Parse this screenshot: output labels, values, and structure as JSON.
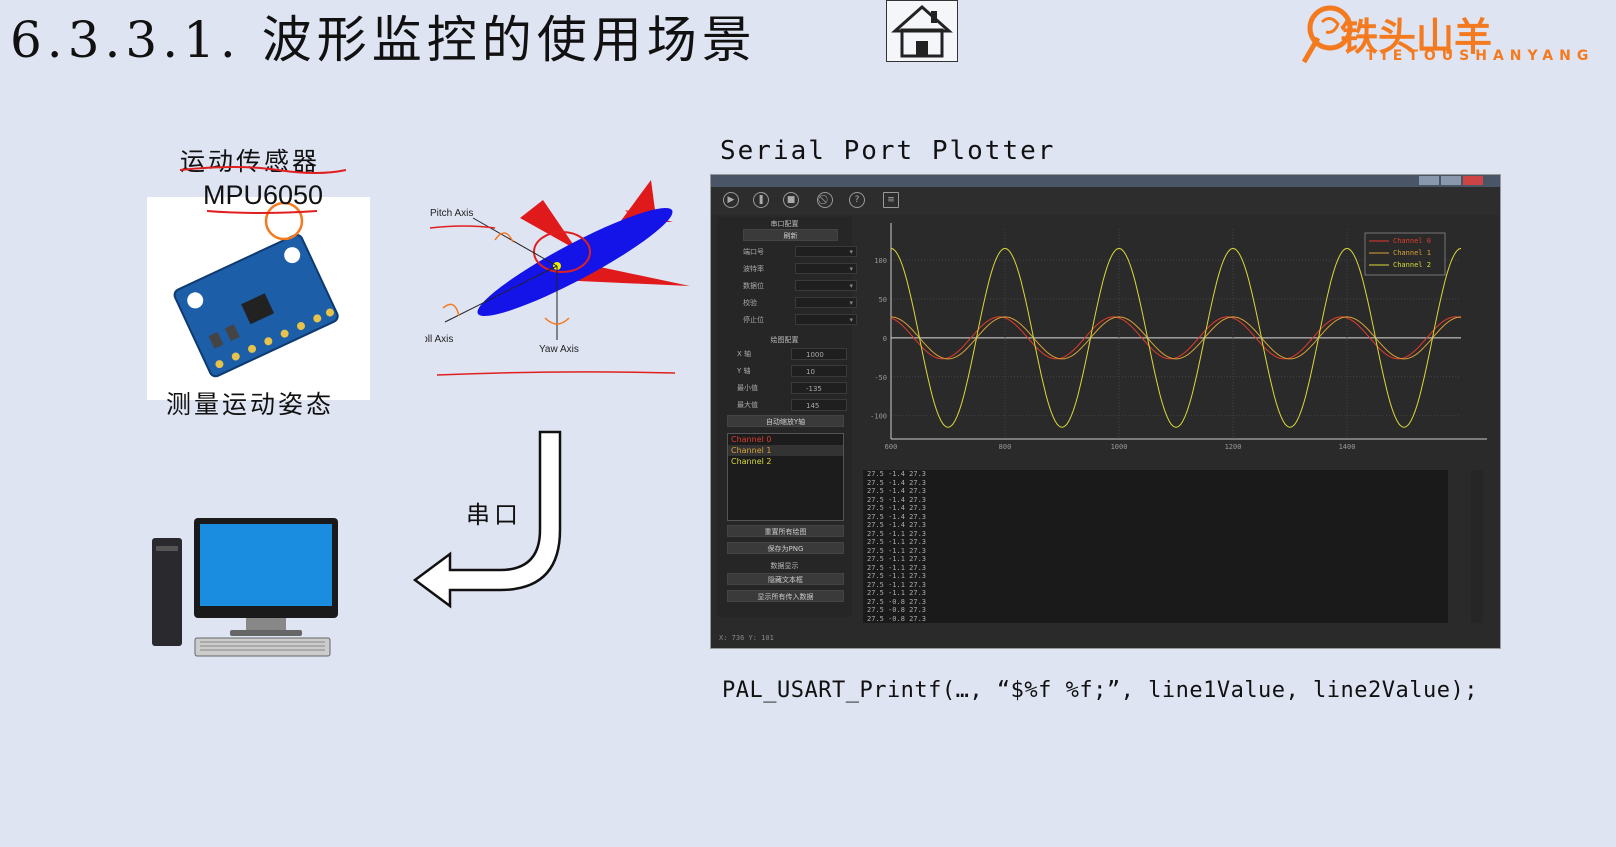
{
  "slide": {
    "title": "6.3.3.1. 波形监控的使用场景",
    "logo": {
      "main": "铁头山羊",
      "sub": "TIETOUSHANYANG"
    }
  },
  "sensor": {
    "label": "运动传感器",
    "model": "MPU6050",
    "caption": "测量运动姿态"
  },
  "airplane": {
    "pitch_axis": "Pitch Axis",
    "roll_axis": "Roll Axis",
    "yaw_axis": "Yaw Axis"
  },
  "link": {
    "label": "串口"
  },
  "plotter": {
    "title": "Serial Port Plotter",
    "toolbar": [
      "play-icon",
      "pause-icon",
      "stop-icon",
      "clear-icon",
      "help-icon",
      "document-icon"
    ],
    "sections": {
      "port_config": "串口配置",
      "refresh": "刷新",
      "port": "端口号",
      "baud": "波特率",
      "data_bits": "数据位",
      "parity": "校验",
      "stop_bits": "停止位",
      "plot_config": "绘图配置",
      "x_axis": "X 轴",
      "y_axis": "Y 轴",
      "min": "最小值",
      "max": "最大值",
      "auto_scale": "自动缩放Y轴",
      "reset_plots": "重置所有绘图",
      "save_png": "保存为PNG",
      "data_display": "数据显示",
      "hide_text": "隐藏文本框",
      "show_all": "显示所有传入数据"
    },
    "values": {
      "x": "1000",
      "y": "10",
      "min": "-135",
      "max": "145"
    },
    "channels": [
      {
        "name": "Channel 0",
        "color": "#e23b2e"
      },
      {
        "name": "Channel 1",
        "color": "#d8a236"
      },
      {
        "name": "Channel 2",
        "color": "#d9d93a"
      }
    ],
    "status": "X: 736 Y: 101",
    "console_lines": [
      "27.5 -1.4 27.3",
      "27.5 -1.4 27.3",
      "27.5 -1.4 27.3",
      "27.5 -1.4 27.3",
      "27.5 -1.4 27.3",
      "27.5 -1.4 27.3",
      "27.5 -1.4 27.3",
      "27.5 -1.1 27.3",
      "27.5 -1.1 27.3",
      "27.5 -1.1 27.3",
      "27.5 -1.1 27.3",
      "27.5 -1.1 27.3",
      "27.5 -1.1 27.3",
      "27.5 -1.1 27.3",
      "27.5 -1.1 27.3",
      "27.5 -0.8 27.3",
      "27.5 -0.8 27.3",
      "27.5 -0.8 27.3",
      "27.5 -0.8 27.3",
      "27.5 -0.8 27.3"
    ]
  },
  "chart_data": {
    "type": "line",
    "x_ticks": [
      "600",
      "800",
      "1000",
      "1200",
      "1400"
    ],
    "y_ticks": [
      "100",
      "50",
      "0",
      "-50",
      "-100"
    ],
    "xlim": [
      600,
      1600
    ],
    "ylim": [
      -130,
      140
    ],
    "grid": true,
    "legend_position": "top-right",
    "series": [
      {
        "name": "Channel 0",
        "color": "#e23b2e",
        "amplitude": 27,
        "period": 200,
        "phase": 10,
        "offset": 0
      },
      {
        "name": "Channel 1",
        "color": "#d8a236",
        "amplitude": 27,
        "period": 200,
        "phase": 0,
        "offset": 0
      },
      {
        "name": "Channel 2",
        "color": "#d9d93a",
        "amplitude": 115,
        "period": 200,
        "phase": 0,
        "offset": 0
      }
    ]
  },
  "code": {
    "line": "PAL_USART_Printf(…, “$%f %f;”, line1Value, line2Value);"
  }
}
